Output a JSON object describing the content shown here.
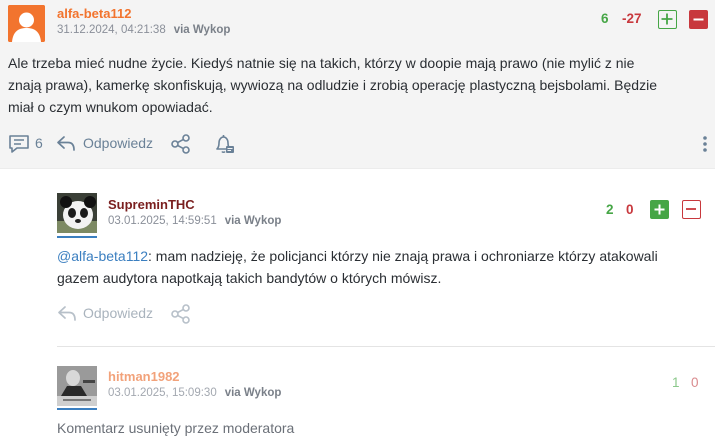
{
  "colors": {
    "orange_author": "#f2742e",
    "red_author": "#7a1f1f",
    "green": "#46a646",
    "red": "#c8383d",
    "link": "#3b7fc0"
  },
  "main_entry": {
    "author": "alfa-beta112",
    "date": "31.12.2024, 04:21:38",
    "via": "via Wykop",
    "plus_count": "6",
    "minus_count": "-27",
    "text_lines": [
      "Ale trzeba mieć nudne życie. Kiedyś natnie się na takich, którzy w doopie mają prawo (nie mylić z nie",
      "znają prawa), kamerkę skonfiskują, wywiozą na odludzie i zrobią operację plastyczną bejsbolami. Będzie",
      "miał o czym wnukom opowiadać."
    ],
    "comments_count": "6",
    "reply_label": "Odpowiedz"
  },
  "reply1": {
    "author": "SupreminTHC",
    "date": "03.01.2025, 14:59:51",
    "via": "via Wykop",
    "plus_count": "2",
    "minus_count": "0",
    "mention": "@alfa-beta112",
    "text_line1_rest": ": mam nadzieję, że policjanci którzy nie znają prawa i ochroniarze którzy atakowali",
    "text_line2": "gazem audytora napotkają takich bandytów o których mówisz.",
    "reply_label": "Odpowiedz"
  },
  "reply2": {
    "author": "hitman1982",
    "date": "03.01.2025, 15:09:30",
    "via": "via Wykop",
    "plus_count": "1",
    "minus_count": "0",
    "deleted_text": "Komentarz usunięty przez moderatora"
  }
}
